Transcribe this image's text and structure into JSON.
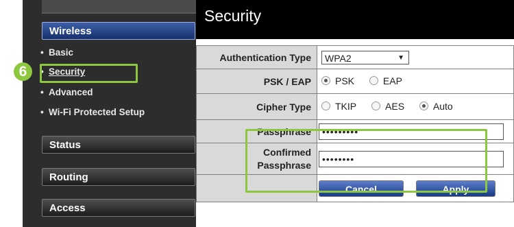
{
  "sidebar": {
    "wireless_label": "Wireless",
    "items": [
      {
        "label": "Basic"
      },
      {
        "label": "Security"
      },
      {
        "label": "Advanced"
      },
      {
        "label": "Wi-Fi Protected Setup"
      }
    ],
    "status_label": "Status",
    "routing_label": "Routing",
    "access_label": "Access"
  },
  "step_badge": "6",
  "page": {
    "title": "Security"
  },
  "form": {
    "auth_type_label": "Authentication Type",
    "auth_type_value": "WPA2",
    "psk_eap_label": "PSK / EAP",
    "psk_option": "PSK",
    "eap_option": "EAP",
    "cipher_label": "Cipher Type",
    "cipher_tkip": "TKIP",
    "cipher_aes": "AES",
    "cipher_auto": "Auto",
    "passphrase_label": "Passphrase",
    "passphrase_value": "•••••••••",
    "confirmed_label_line1": "Confirmed",
    "confirmed_label_line2": "Passphrase",
    "confirmed_value": "••••••••",
    "cancel_label": "Cancel",
    "apply_label": "Apply"
  },
  "colors": {
    "highlight": "#8dc63f",
    "sidebar_bg": "#2d2d2d",
    "button_blue": "#1f4fa8"
  }
}
